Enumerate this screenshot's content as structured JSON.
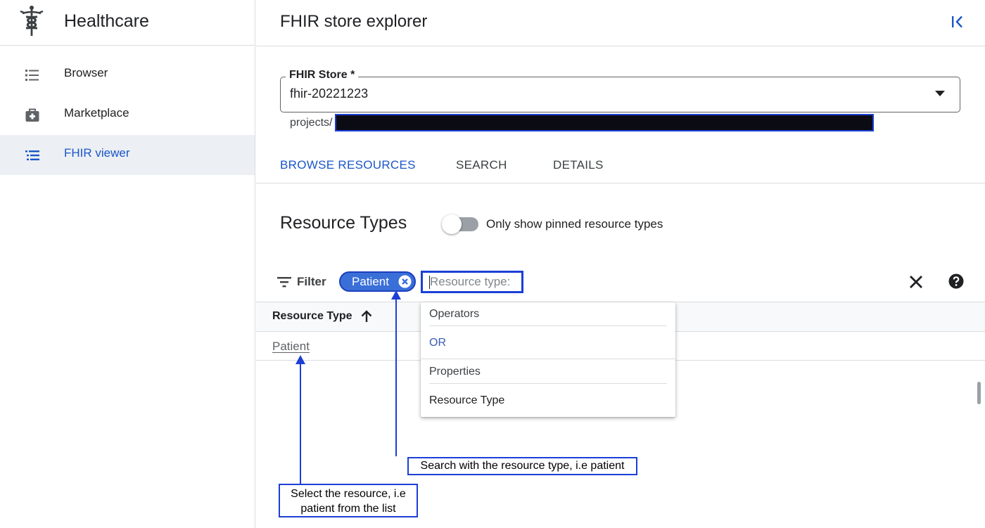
{
  "sidebar": {
    "app_title": "Healthcare",
    "items": [
      {
        "label": "Browser",
        "icon": "list-icon"
      },
      {
        "label": "Marketplace",
        "icon": "medical-bag-icon"
      },
      {
        "label": "FHIR viewer",
        "icon": "fhir-list-icon",
        "active": true
      }
    ]
  },
  "header": {
    "title": "FHIR store explorer"
  },
  "store": {
    "label": "FHIR Store *",
    "value": "fhir-20221223",
    "project_prefix": "projects/"
  },
  "tabs": [
    {
      "label": "BROWSE RESOURCES",
      "active": true
    },
    {
      "label": "SEARCH"
    },
    {
      "label": "DETAILS"
    }
  ],
  "resource_types": {
    "title": "Resource Types",
    "toggle_label": "Only show pinned resource types",
    "toggle_on": false
  },
  "filter": {
    "label": "Filter",
    "chip": "Patient",
    "placeholder": "Resource type:"
  },
  "dropdown": {
    "sections": [
      {
        "header": "Operators",
        "items": [
          "OR"
        ]
      },
      {
        "header": "Properties",
        "items": [
          "Resource Type"
        ]
      }
    ]
  },
  "table": {
    "column": "Resource Type",
    "rows": [
      "Patient"
    ]
  },
  "annotations": {
    "search_note": "Search with the resource type, i.e patient",
    "select_note_line1": "Select the resource, i.e",
    "select_note_line2": "patient from the list"
  },
  "colors": {
    "accent_blue": "#1a56c9",
    "annotation_blue": "#1c3fd6",
    "chip_blue": "#3a6fd8",
    "active_nav_bg": "#eceff4"
  }
}
